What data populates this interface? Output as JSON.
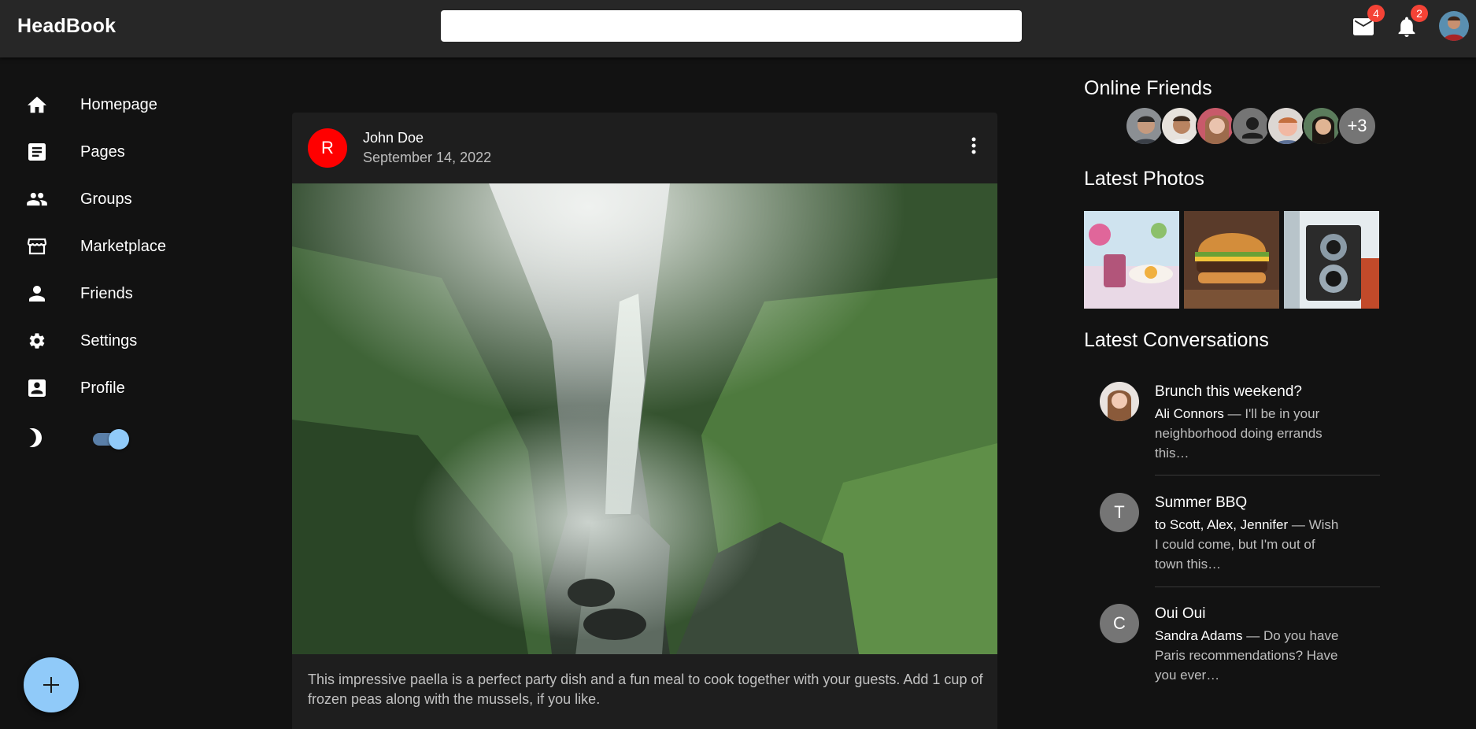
{
  "app": {
    "brand": "HeadBook"
  },
  "header": {
    "search_placeholder": "",
    "mail_badge": "4",
    "notifications_badge": "2"
  },
  "sidebar": {
    "items": [
      {
        "label": "Homepage",
        "icon": "home-icon"
      },
      {
        "label": "Pages",
        "icon": "article-icon"
      },
      {
        "label": "Groups",
        "icon": "group-icon"
      },
      {
        "label": "Marketplace",
        "icon": "storefront-icon"
      },
      {
        "label": "Friends",
        "icon": "person-icon"
      },
      {
        "label": "Settings",
        "icon": "gear-icon"
      },
      {
        "label": "Profile",
        "icon": "account-box-icon"
      }
    ],
    "dark_mode": true,
    "fab_label": "+"
  },
  "post": {
    "avatar_letter": "R",
    "author": "John Doe",
    "date": "September 14, 2022",
    "text": "This impressive paella is a perfect party dish and a fun meal to cook together with your guests. Add 1 cup of frozen peas along with the mussels, if you like."
  },
  "right": {
    "online_friends_title": "Online Friends",
    "more_friends": "+3",
    "latest_photos_title": "Latest Photos",
    "latest_conversations_title": "Latest Conversations",
    "conversations": [
      {
        "avatar_letter": "",
        "subject": "Brunch this weekend?",
        "who": "Ali Connors",
        "preview": " — I'll be in your neighborhood doing errands this…"
      },
      {
        "avatar_letter": "T",
        "subject": "Summer BBQ",
        "who": "to Scott, Alex, Jennifer",
        "preview": " — Wish I could come, but I'm out of town this…"
      },
      {
        "avatar_letter": "C",
        "subject": "Oui Oui",
        "who": "Sandra Adams",
        "preview": " — Do you have Paris recommendations? Have you ever…"
      }
    ]
  },
  "colors": {
    "appbar": "#272727",
    "background": "#121212",
    "card": "#1e1e1e",
    "accent": "#90caf9",
    "badge": "#f44336",
    "post_avatar": "#ff0000"
  }
}
